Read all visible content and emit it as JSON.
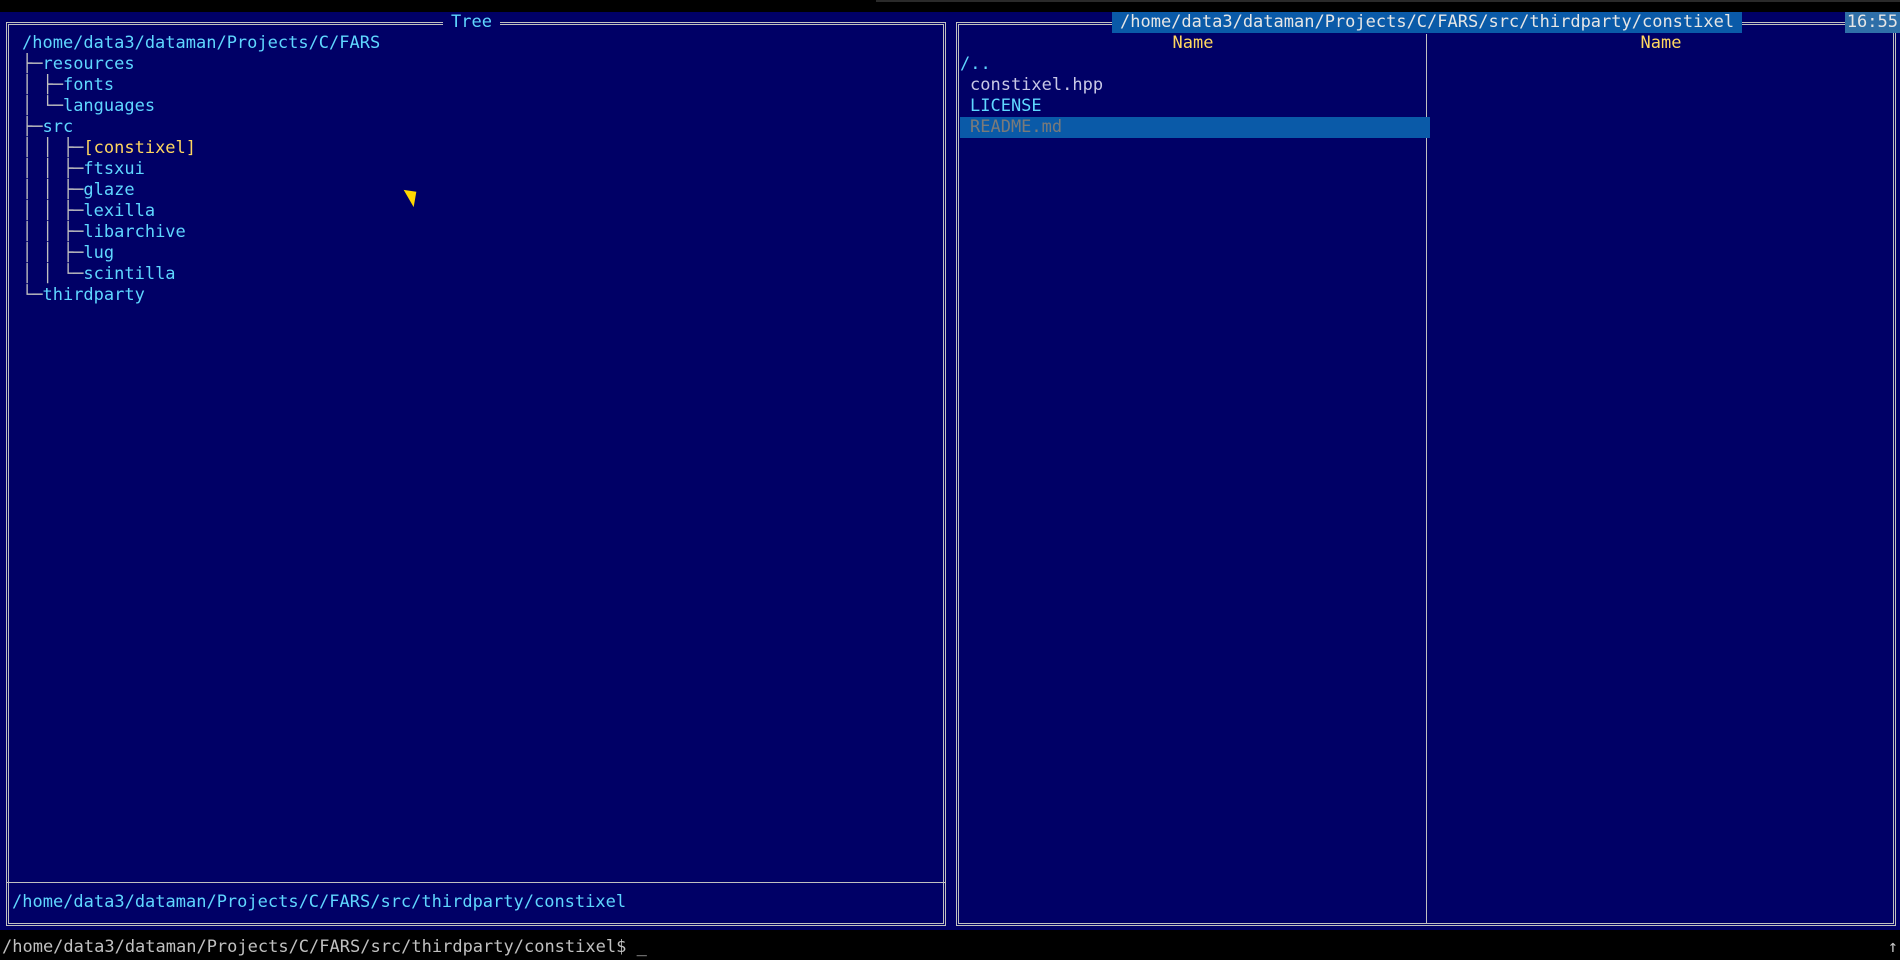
{
  "clock": "16:55",
  "left_panel": {
    "title": "Tree",
    "root": "/home/data3/dataman/Projects/C/FARS",
    "tree": [
      {
        "prefix": "├─",
        "label": "resources"
      },
      {
        "prefix": "│ ├─",
        "label": "fonts"
      },
      {
        "prefix": "│ └─",
        "label": "languages"
      },
      {
        "prefix": "├─",
        "label": "src"
      },
      {
        "prefix": "│ │ ├─",
        "label": "[constixel]",
        "current": true
      },
      {
        "prefix": "│ │ ├─",
        "label": "ftsxui"
      },
      {
        "prefix": "│ │ ├─",
        "label": "glaze"
      },
      {
        "prefix": "│ │ ├─",
        "label": "lexilla"
      },
      {
        "prefix": "│ │ ├─",
        "label": "libarchive"
      },
      {
        "prefix": "│ │ ├─",
        "label": "lug"
      },
      {
        "prefix": "│ │ └─",
        "label": "scintilla"
      },
      {
        "prefix": "└─",
        "label": "thirdparty"
      }
    ],
    "status_path": "/home/data3/dataman/Projects/C/FARS/src/thirdparty/constixel"
  },
  "right_panel": {
    "title": "/home/data3/dataman/Projects/C/FARS/src/thirdparty/constixel",
    "column_headers": [
      "Name",
      "Name"
    ],
    "files": [
      {
        "name": "/..",
        "kind": "up"
      },
      {
        "name": "constixel.hpp",
        "kind": "file"
      },
      {
        "name": "LICENSE",
        "kind": "license"
      },
      {
        "name": "README.md",
        "kind": "file",
        "selected": true
      }
    ]
  },
  "command_line": {
    "prompt": "/home/data3/dataman/Projects/C/FARS/src/thirdparty/constixel$ ",
    "cursor": "_",
    "scroll_indicator": "↑"
  }
}
